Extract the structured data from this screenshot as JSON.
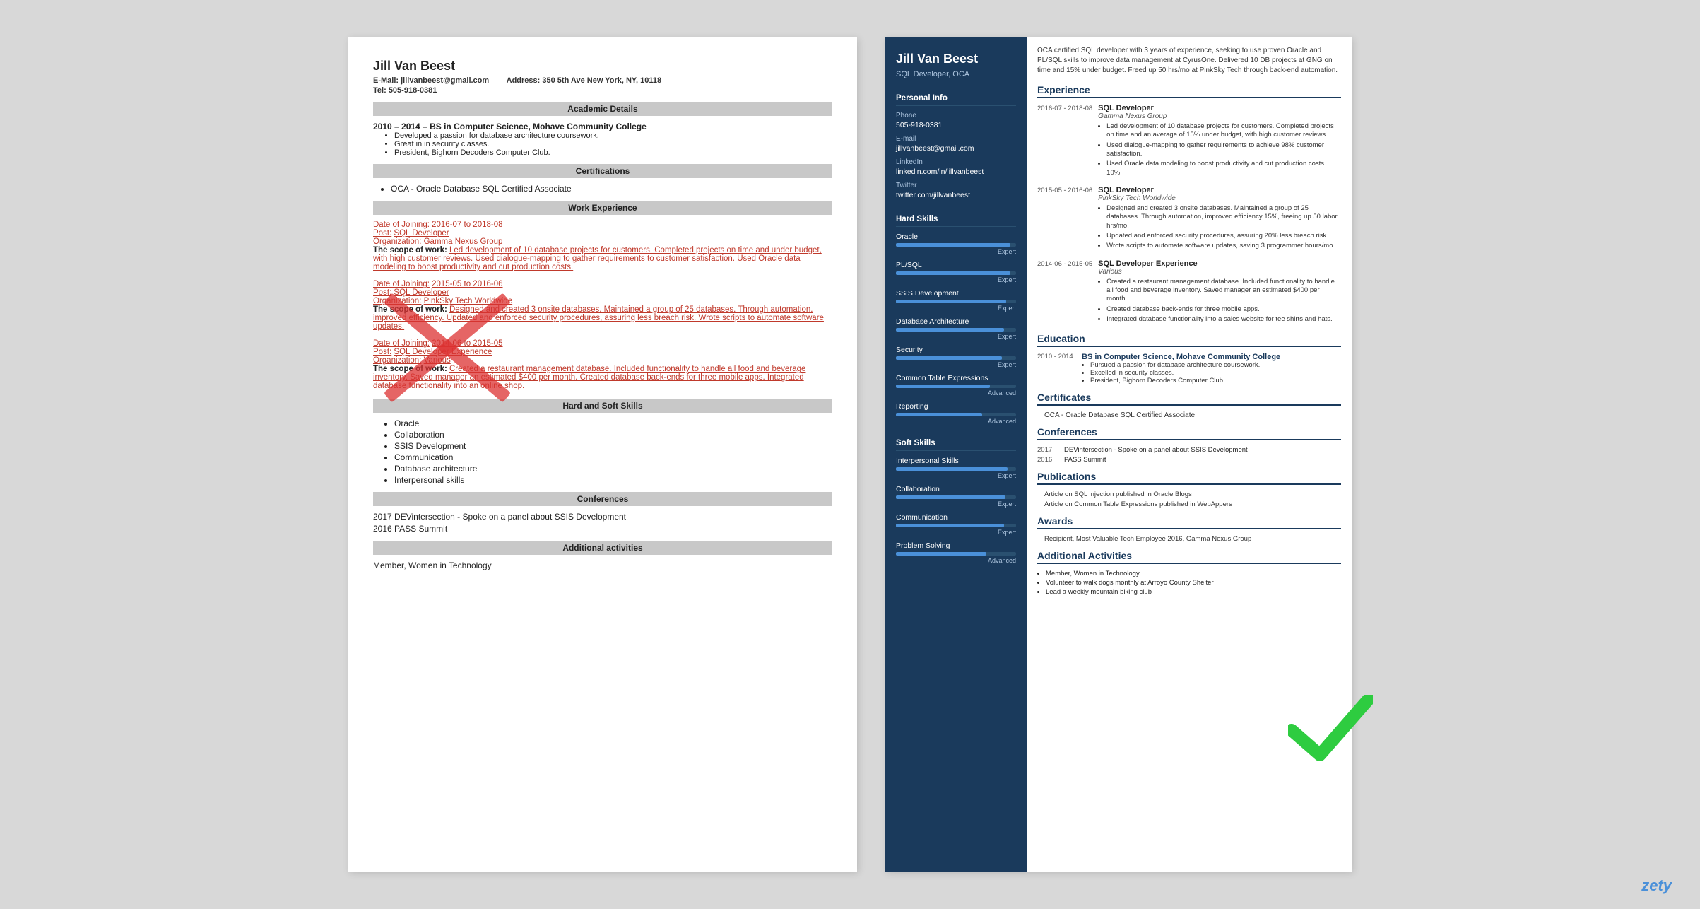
{
  "left_resume": {
    "name": "Jill Van Beest",
    "email_label": "E-Mail:",
    "email": "jillvanbeest@gmail.com",
    "address_label": "Address:",
    "address": "350 5th Ave New York, NY, 10118",
    "tel_label": "Tel:",
    "tel": "505-918-0381",
    "sections": {
      "academic": {
        "title": "Academic Details",
        "entries": [
          {
            "date": "2010 – 2014 –",
            "degree": "BS in Computer Science, Mohave Community College",
            "bullets": [
              "Developed a passion for database architecture coursework.",
              "Great in in security classes.",
              "President, Bighorn Decoders Computer Club."
            ]
          }
        ]
      },
      "certifications": {
        "title": "Certifications",
        "items": [
          "OCA - Oracle Database SQL Certified Associate"
        ]
      },
      "work_experience": {
        "title": "Work Experience",
        "entries": [
          {
            "date_label": "Date of Joining:",
            "date": "2016-07 to 2018-08",
            "post_label": "Post:",
            "post": "SQL Developer",
            "org_label": "Organization:",
            "org": "Gamma Nexus Group",
            "scope_label": "The scope of work:",
            "scope": "Led development of 10 database projects for customers. Completed projects on time and under budget, with high customer reviews. Used dialogue-mapping to gather requirements to customer satisfaction. Used Oracle data modeling to boost productivity and cut production costs."
          },
          {
            "date_label": "Date of Joining:",
            "date": "2015-05 to 2016-06",
            "post_label": "Post:",
            "post": "SQL Developer",
            "org_label": "Organization:",
            "org": "PinkSky Tech Worldwide",
            "scope_label": "The scope of work:",
            "scope": "Designed and created 3 onsite databases. Maintained a group of 25 databases. Through automation, improved efficiency. Updated and enforced security procedures, assuring less breach risk. Wrote scripts to automate software updates."
          },
          {
            "date_label": "Date of Joining:",
            "date": "2014-06 to 2015-05",
            "post_label": "Post:",
            "post": "SQL Developer Experience",
            "org_label": "Organization:",
            "org": "Various",
            "scope_label": "The scope of work:",
            "scope": "Created a restaurant management database. Included functionality to handle all food and beverage inventory. Saved manager an estimated $400 per month. Created database back-ends for three mobile apps. Integrated database functionality into an online shop."
          }
        ]
      },
      "skills": {
        "title": "Hard and Soft Skills",
        "items": [
          "Oracle",
          "Collaboration",
          "SSIS Development",
          "Communication",
          "Database architecture",
          "Interpersonal skills"
        ]
      },
      "conferences": {
        "title": "Conferences",
        "items": [
          "2017 DEVintersection - Spoke on a panel about SSIS Development",
          "2016 PASS Summit"
        ]
      },
      "additional": {
        "title": "Additional activities",
        "items": [
          "Member, Women in Technology"
        ]
      }
    }
  },
  "right_resume": {
    "name": "Jill Van Beest",
    "title": "SQL Developer, OCA",
    "summary": "OCA certified SQL developer with 3 years of experience, seeking to use proven Oracle and PL/SQL skills to improve data management at CyrusOne. Delivered 10 DB projects at GNG on time and 15% under budget. Freed up 50 hrs/mo at PinkSky Tech through back-end automation.",
    "personal_info": {
      "section_title": "Personal Info",
      "phone_label": "Phone",
      "phone": "505-918-0381",
      "email_label": "E-mail",
      "email": "jillvanbeest@gmail.com",
      "linkedin_label": "LinkedIn",
      "linkedin": "linkedin.com/in/jillvanbeest",
      "twitter_label": "Twitter",
      "twitter": "twitter.com/jillvanbeest"
    },
    "hard_skills": {
      "section_title": "Hard Skills",
      "skills": [
        {
          "name": "Oracle",
          "level": "Expert",
          "pct": 95
        },
        {
          "name": "PL/SQL",
          "level": "Expert",
          "pct": 95
        },
        {
          "name": "SSIS Development",
          "level": "Expert",
          "pct": 92
        },
        {
          "name": "Database Architecture",
          "level": "Expert",
          "pct": 90
        },
        {
          "name": "Security",
          "level": "Expert",
          "pct": 88
        },
        {
          "name": "Common Table Expressions",
          "level": "Advanced",
          "pct": 78
        },
        {
          "name": "Reporting",
          "level": "Advanced",
          "pct": 72
        }
      ]
    },
    "soft_skills": {
      "section_title": "Soft Skills",
      "skills": [
        {
          "name": "Interpersonal Skills",
          "level": "Expert",
          "pct": 93
        },
        {
          "name": "Collaboration",
          "level": "Expert",
          "pct": 91
        },
        {
          "name": "Communication",
          "level": "Expert",
          "pct": 90
        },
        {
          "name": "Problem Solving",
          "level": "Advanced",
          "pct": 75
        }
      ]
    },
    "experience": {
      "section_title": "Experience",
      "entries": [
        {
          "date": "2016-07 -\n2018-08",
          "job_title": "SQL Developer",
          "company": "Gamma Nexus Group",
          "bullets": [
            "Led development of 10 database projects for customers. Completed projects on time and an average of 15% under budget, with high customer reviews.",
            "Used dialogue-mapping to gather requirements to achieve 98% customer satisfaction.",
            "Used Oracle data modeling to boost productivity and cut production costs 10%."
          ]
        },
        {
          "date": "2015-05 -\n2016-06",
          "job_title": "SQL Developer",
          "company": "PinkSky Tech Worldwide",
          "bullets": [
            "Designed and created 3 onsite databases. Maintained a group of 25 databases. Through automation, improved efficiency 15%, freeing up 50 labor hrs/mo.",
            "Updated and enforced security procedures, assuring 20% less breach risk.",
            "Wrote scripts to automate software updates, saving 3 programmer hours/mo."
          ]
        },
        {
          "date": "2014-06 -\n2015-05",
          "job_title": "SQL Developer Experience",
          "company": "Various",
          "bullets": [
            "Created a restaurant management database. Included functionality to handle all food and beverage inventory. Saved manager an estimated $400 per month.",
            "Created database back-ends for three mobile apps.",
            "Integrated database functionality into a sales website for tee shirts and hats."
          ]
        }
      ]
    },
    "education": {
      "section_title": "Education",
      "entries": [
        {
          "date": "2010 -\n2014",
          "degree": "BS in Computer Science, Mohave Community College",
          "bullets": [
            "Pursued a passion for database architecture coursework.",
            "Excelled in security classes.",
            "President, Bighorn Decoders Computer Club."
          ]
        }
      ]
    },
    "certificates": {
      "section_title": "Certificates",
      "items": [
        "OCA - Oracle Database SQL Certified Associate"
      ]
    },
    "conferences": {
      "section_title": "Conferences",
      "entries": [
        {
          "year": "2017",
          "text": "DEVintersection - Spoke on a panel about SSIS Development"
        },
        {
          "year": "2016",
          "text": "PASS Summit"
        }
      ]
    },
    "publications": {
      "section_title": "Publications",
      "items": [
        "Article on SQL injection published in Oracle Blogs",
        "Article on Common Table Expressions published in WebAppers"
      ]
    },
    "awards": {
      "section_title": "Awards",
      "items": [
        "Recipient, Most Valuable Tech Employee 2016, Gamma Nexus Group"
      ]
    },
    "additional": {
      "section_title": "Additional Activities",
      "items": [
        "Member, Women in Technology",
        "Volunteer to walk dogs monthly at Arroyo County Shelter",
        "Lead a weekly mountain biking club"
      ]
    }
  },
  "brand": {
    "name": "zety"
  }
}
